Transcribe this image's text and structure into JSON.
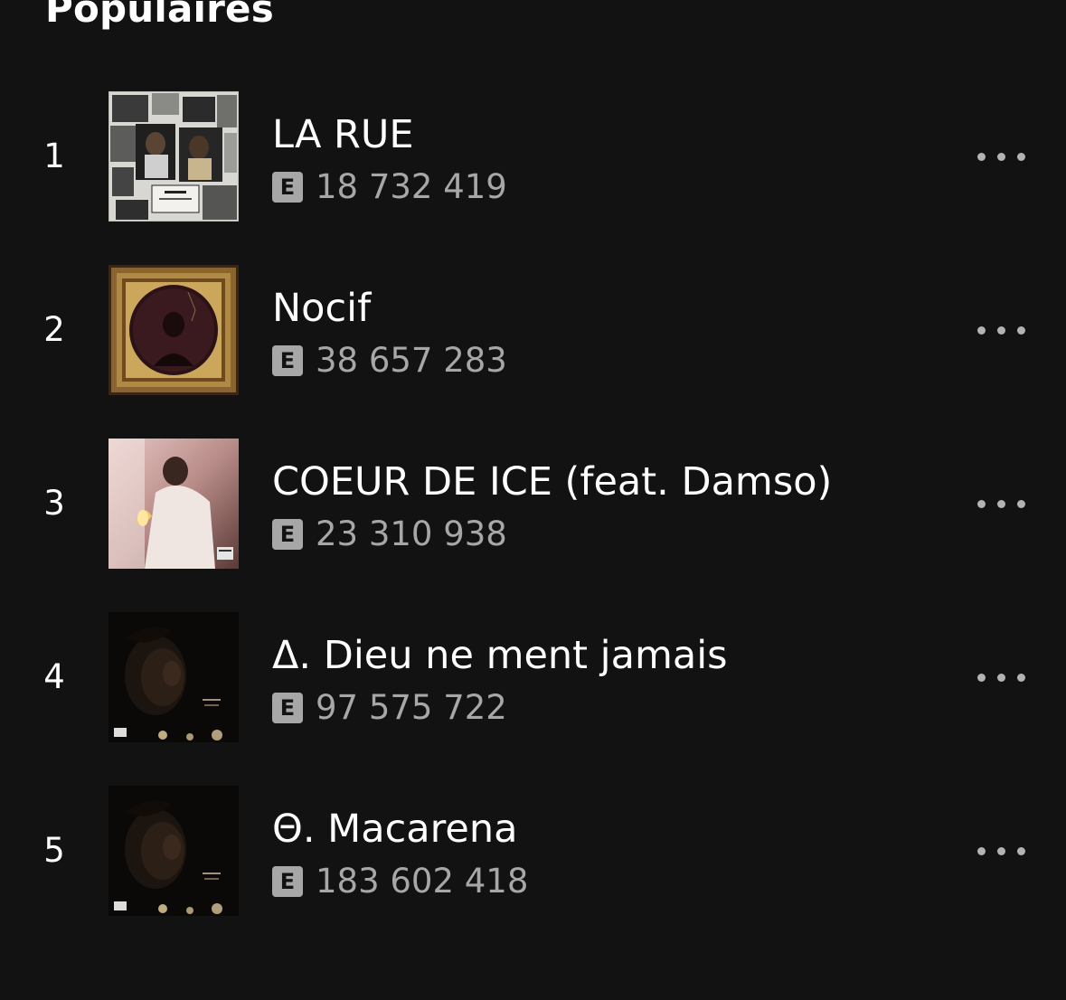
{
  "section": {
    "title": "Populaires"
  },
  "tracks": [
    {
      "rank": "1",
      "title": "LA RUE",
      "explicit_label": "E",
      "plays": "18 732 419",
      "art": "album-art-la-rue"
    },
    {
      "rank": "2",
      "title": "Nocif",
      "explicit_label": "E",
      "plays": "38 657 283",
      "art": "album-art-nocif"
    },
    {
      "rank": "3",
      "title": "COEUR DE ICE (feat. Damso)",
      "explicit_label": "E",
      "plays": "23 310 938",
      "art": "album-art-coeur-de-ice"
    },
    {
      "rank": "4",
      "title": "Δ. Dieu ne ment jamais",
      "explicit_label": "E",
      "plays": "97 575 722",
      "art": "album-art-ipseite"
    },
    {
      "rank": "5",
      "title": "Θ. Macarena",
      "explicit_label": "E",
      "plays": "183 602 418",
      "art": "album-art-ipseite"
    }
  ],
  "colors": {
    "background": "#121212",
    "text_primary": "#ffffff",
    "text_secondary": "#a7a7a7"
  },
  "icons": {
    "more": "more-options-icon",
    "explicit": "explicit-badge"
  }
}
